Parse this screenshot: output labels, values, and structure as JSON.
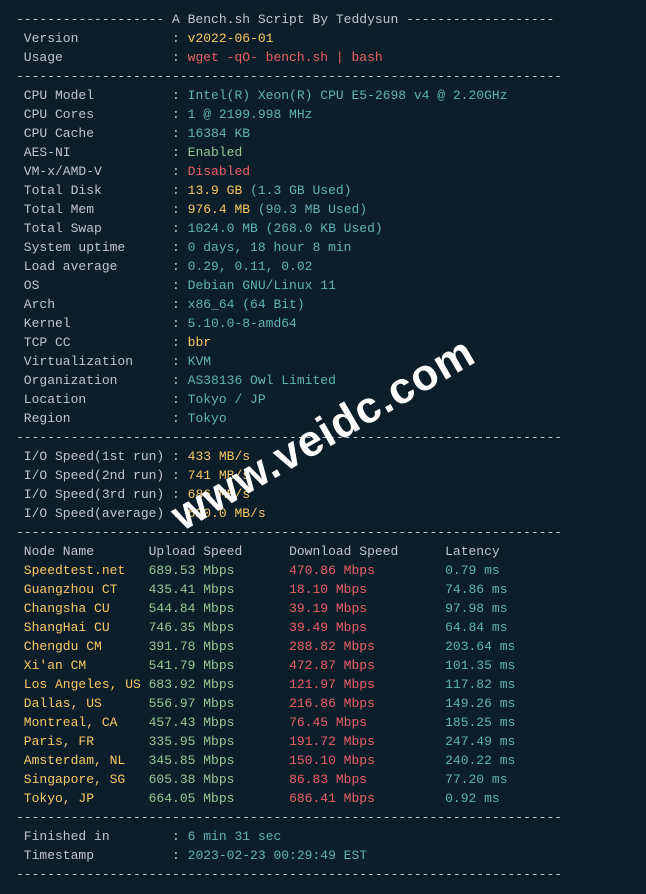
{
  "header": {
    "title": "A Bench.sh Script By Teddysun"
  },
  "version_label": " Version",
  "version_value": "v2022-06-01",
  "usage_label": " Usage",
  "usage_value": "wget -qO- bench.sh | bash",
  "sys": [
    {
      "label": " CPU Model",
      "value": "Intel(R) Xeon(R) CPU E5-2698 v4 @ 2.20GHz",
      "class": "cyan"
    },
    {
      "label": " CPU Cores",
      "value": "1 @ 2199.998 MHz",
      "class": "cyan"
    },
    {
      "label": " CPU Cache",
      "value": "16384 KB",
      "class": "cyan"
    },
    {
      "label": " AES-NI",
      "value": "Enabled",
      "class": "green"
    },
    {
      "label": " VM-x/AMD-V",
      "value": "Disabled",
      "class": "red"
    }
  ],
  "disk_label": " Total Disk",
  "disk_value": "13.9 GB",
  "disk_used": "(1.3 GB Used)",
  "mem_label": " Total Mem",
  "mem_value": "976.4 MB",
  "mem_used": "(90.3 MB Used)",
  "swap_label": " Total Swap",
  "swap_value": "1024.0 MB (268.0 KB Used)",
  "sys2": [
    {
      "label": " System uptime",
      "value": "0 days, 18 hour 8 min",
      "class": "cyan"
    },
    {
      "label": " Load average",
      "value": "0.29, 0.11, 0.02",
      "class": "cyan"
    },
    {
      "label": " OS",
      "value": "Debian GNU/Linux 11",
      "class": "cyan"
    },
    {
      "label": " Arch",
      "value": "x86_64 (64 Bit)",
      "class": "cyan"
    },
    {
      "label": " Kernel",
      "value": "5.10.0-8-amd64",
      "class": "cyan"
    },
    {
      "label": " TCP CC",
      "value": "bbr",
      "class": "yellow"
    },
    {
      "label": " Virtualization",
      "value": "KVM",
      "class": "cyan"
    },
    {
      "label": " Organization",
      "value": "AS38136 Owl Limited",
      "class": "cyan"
    },
    {
      "label": " Location",
      "value": "Tokyo / JP",
      "class": "cyan"
    },
    {
      "label": " Region",
      "value": "Tokyo",
      "class": "cyan"
    }
  ],
  "io": [
    {
      "label": " I/O Speed(1st run) ",
      "value": "433 MB/s"
    },
    {
      "label": " I/O Speed(2nd run) ",
      "value": "741 MB/s"
    },
    {
      "label": " I/O Speed(3rd run) ",
      "value": "686 MB/s"
    },
    {
      "label": " I/O Speed(average) ",
      "value": "620.0 MB/s"
    }
  ],
  "net_header": {
    "node": " Node Name",
    "upload": "Upload Speed",
    "download": "Download Speed",
    "latency": "Latency"
  },
  "net": [
    {
      "node": " Speedtest.net",
      "up": "689.53 Mbps",
      "down": "470.86 Mbps",
      "lat": "0.79 ms"
    },
    {
      "node": " Guangzhou CT",
      "up": "435.41 Mbps",
      "down": "18.10 Mbps",
      "lat": "74.86 ms"
    },
    {
      "node": " Changsha CU",
      "up": "544.84 Mbps",
      "down": "39.19 Mbps",
      "lat": "97.98 ms"
    },
    {
      "node": " ShangHai CU",
      "up": "746.35 Mbps",
      "down": "39.49 Mbps",
      "lat": "64.84 ms"
    },
    {
      "node": " Chengdu CM",
      "up": "391.78 Mbps",
      "down": "288.82 Mbps",
      "lat": "203.64 ms"
    },
    {
      "node": " Xi'an CM",
      "up": "541.79 Mbps",
      "down": "472.87 Mbps",
      "lat": "101.35 ms"
    },
    {
      "node": " Los Angeles, US",
      "up": "683.92 Mbps",
      "down": "121.97 Mbps",
      "lat": "117.82 ms"
    },
    {
      "node": " Dallas, US",
      "up": "556.97 Mbps",
      "down": "216.86 Mbps",
      "lat": "149.26 ms"
    },
    {
      "node": " Montreal, CA",
      "up": "457.43 Mbps",
      "down": "76.45 Mbps",
      "lat": "185.25 ms"
    },
    {
      "node": " Paris, FR",
      "up": "335.95 Mbps",
      "down": "191.72 Mbps",
      "lat": "247.49 ms"
    },
    {
      "node": " Amsterdam, NL",
      "up": "345.85 Mbps",
      "down": "150.10 Mbps",
      "lat": "240.22 ms"
    },
    {
      "node": " Singapore, SG",
      "up": "605.38 Mbps",
      "down": "86.83 Mbps",
      "lat": "77.20 ms"
    },
    {
      "node": " Tokyo, JP",
      "up": "664.05 Mbps",
      "down": "686.41 Mbps",
      "lat": "0.92 ms"
    }
  ],
  "footer": [
    {
      "label": " Finished in",
      "value": "6 min 31 sec"
    },
    {
      "label": " Timestamp",
      "value": "2023-02-23 00:29:49 EST"
    }
  ],
  "dashes_wide": "----------------------------------------------------------------------",
  "dashes_head_pre": "------------------- ",
  "dashes_head_post": " -------------------",
  "watermark": "www.veidc.com"
}
